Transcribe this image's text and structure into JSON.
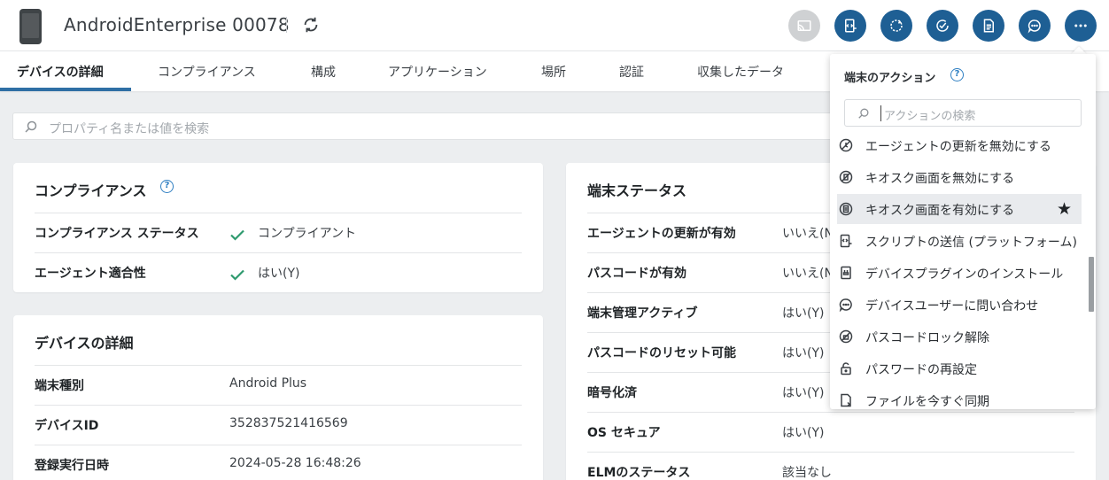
{
  "header": {
    "device_name": "AndroidEnterprise 00078",
    "actions": [
      {
        "icon": "cast-icon",
        "disabled": true
      },
      {
        "icon": "send-script-icon",
        "disabled": false
      },
      {
        "icon": "sync-icon",
        "disabled": false
      },
      {
        "icon": "check-compliance-icon",
        "disabled": false
      },
      {
        "icon": "document-icon",
        "disabled": false
      },
      {
        "icon": "chat-icon",
        "disabled": false
      },
      {
        "icon": "more-icon",
        "disabled": false
      }
    ]
  },
  "tabs": [
    {
      "label": "デバイスの詳細",
      "active": true
    },
    {
      "label": "コンプライアンス"
    },
    {
      "label": "構成"
    },
    {
      "label": "アプリケーション"
    },
    {
      "label": "場所"
    },
    {
      "label": "認証"
    },
    {
      "label": "収集したデータ"
    }
  ],
  "search": {
    "placeholder": "プロパティ名または値を検索"
  },
  "compliance_card": {
    "title": "コンプライアンス",
    "help": "?",
    "rows": [
      {
        "label": "コンプライアンス ステータス",
        "value": "コンプライアント"
      },
      {
        "label": "エージェント適合性",
        "value": "はい(Y)"
      }
    ]
  },
  "details_card": {
    "title": "デバイスの詳細",
    "rows": [
      {
        "label": "端末種別",
        "value": "Android Plus"
      },
      {
        "label": "デバイスID",
        "value": "352837521416569"
      },
      {
        "label": "登録実行日時",
        "value": "2024-05-28 16:48:26"
      }
    ]
  },
  "status_card": {
    "title": "端末ステータス",
    "rows": [
      {
        "label": "エージェントの更新が有効",
        "value": "いいえ(N"
      },
      {
        "label": "パスコードが有効",
        "value": "いいえ(N"
      },
      {
        "label": "端末管理アクティブ",
        "value": "はい(Y)"
      },
      {
        "label": "パスコードのリセット可能",
        "value": "はい(Y)"
      },
      {
        "label": "暗号化済",
        "value": "はい(Y)"
      },
      {
        "label": "OS セキュア",
        "value": "はい(Y)"
      },
      {
        "label": "ELMのステータス",
        "value": "該当なし"
      }
    ]
  },
  "actions_menu": {
    "title": "端末のアクション",
    "help": "?",
    "search_placeholder": "アクションの検索",
    "star": "★",
    "items": [
      {
        "label": "エージェントの更新を無効にする",
        "icon": "disable-update-icon"
      },
      {
        "label": "キオスク画面を無効にする",
        "icon": "disable-kiosk-icon"
      },
      {
        "label": "キオスク画面を有効にする",
        "icon": "enable-kiosk-icon",
        "hovered": true,
        "starred": true
      },
      {
        "label": "スクリプトの送信 (プラットフォーム)",
        "icon": "script-icon"
      },
      {
        "label": "デバイスプラグインのインストール",
        "icon": "plugin-icon"
      },
      {
        "label": "デバイスユーザーに問い合わせ",
        "icon": "contact-user-icon"
      },
      {
        "label": "パスコードロック解除",
        "icon": "unlock-passcode-icon"
      },
      {
        "label": "パスワードの再設定",
        "icon": "reset-password-icon"
      },
      {
        "label": "ファイルを今すぐ同期",
        "icon": "sync-file-icon"
      }
    ]
  }
}
